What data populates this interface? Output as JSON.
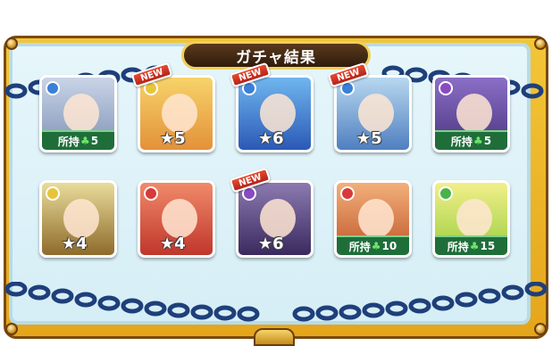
{
  "title": "ガチャ結果",
  "colors": {
    "frame_gold": "#e5a51b",
    "inner_panel": "#d6eef6",
    "owned_bar": "#1f6e3a",
    "new_badge": "#d23320"
  },
  "cards": [
    {
      "element_icon": "water-element-icon",
      "element_color": "#3a7fd8",
      "new": false,
      "stars": "",
      "owned_label": "所持",
      "owned_count": "5",
      "art_top": "#c9d4e6",
      "art_bottom": "#7f93b8"
    },
    {
      "element_icon": "light-element-icon",
      "element_color": "#e7c53a",
      "new": true,
      "new_label": "NEW",
      "stars": "★5",
      "owned_label": "",
      "owned_count": "",
      "art_top": "#f7d36a",
      "art_bottom": "#e3913a"
    },
    {
      "element_icon": "water-element-icon",
      "element_color": "#3a7fd8",
      "new": true,
      "new_label": "NEW",
      "stars": "★6",
      "owned_label": "",
      "owned_count": "",
      "art_top": "#6fb6ef",
      "art_bottom": "#2b59b6"
    },
    {
      "element_icon": "water-element-icon",
      "element_color": "#3a7fd8",
      "new": true,
      "new_label": "NEW",
      "stars": "★5",
      "owned_label": "",
      "owned_count": "",
      "art_top": "#b8d8ef",
      "art_bottom": "#4f7fc0"
    },
    {
      "element_icon": "dark-element-icon",
      "element_color": "#8a4ac2",
      "new": false,
      "stars": "",
      "owned_label": "所持",
      "owned_count": "5",
      "art_top": "#8b6fc7",
      "art_bottom": "#4a357e"
    },
    {
      "element_icon": "light-element-icon",
      "element_color": "#e7c53a",
      "new": false,
      "stars": "★4",
      "owned_label": "",
      "owned_count": "",
      "art_top": "#e9dc9c",
      "art_bottom": "#8e6b2a"
    },
    {
      "element_icon": "fire-element-icon",
      "element_color": "#d83a3a",
      "new": false,
      "stars": "★4",
      "owned_label": "",
      "owned_count": "",
      "art_top": "#f08a6a",
      "art_bottom": "#c0362b"
    },
    {
      "element_icon": "dark-element-icon",
      "element_color": "#8a4ac2",
      "new": true,
      "new_label": "NEW",
      "stars": "★6",
      "owned_label": "",
      "owned_count": "",
      "art_top": "#8c7ab0",
      "art_bottom": "#3a2a5e"
    },
    {
      "element_icon": "fire-element-icon",
      "element_color": "#d83a3a",
      "new": false,
      "stars": "",
      "owned_label": "所持",
      "owned_count": "10",
      "art_top": "#f2b07a",
      "art_bottom": "#c0562b"
    },
    {
      "element_icon": "wood-element-icon",
      "element_color": "#47b34a",
      "new": false,
      "stars": "",
      "owned_label": "所持",
      "owned_count": "15",
      "art_top": "#f1ef8a",
      "art_bottom": "#9ccf3f"
    }
  ]
}
